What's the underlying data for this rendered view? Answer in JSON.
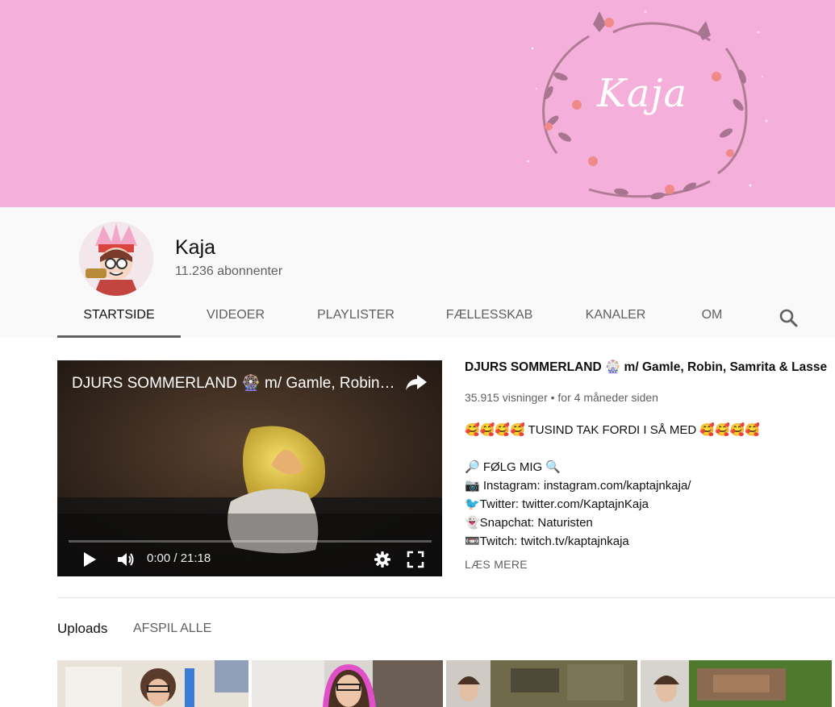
{
  "banner": {
    "name": "Kaja"
  },
  "channel": {
    "name": "Kaja",
    "subscribers": "11.236 abonnenter"
  },
  "tabs": [
    {
      "label": "STARTSIDE",
      "active": true
    },
    {
      "label": "VIDEOER"
    },
    {
      "label": "PLAYLISTER"
    },
    {
      "label": "FÆLLESSKAB"
    },
    {
      "label": "KANALER"
    },
    {
      "label": "OM"
    }
  ],
  "featured": {
    "player_title": "DJURS SOMMERLAND 🎡 m/ Gamle, Robin…",
    "time": "0:00 / 21:18",
    "progress": 0,
    "title": "DJURS SOMMERLAND 🎡 m/ Gamle, Robin, Samrita & Lasse",
    "meta": "35.915 visninger • for 4 måneder siden",
    "description": [
      "🥰🥰🥰🥰 TUSIND TAK FORDI I SÅ MED 🥰🥰🥰🥰",
      "",
      "🔎 FØLG MIG 🔍",
      "📷 Instagram: instagram.com/kaptajnkaja/",
      "🐦Twitter: twitter.com/KaptajnKaja",
      "👻Snapchat: Naturisten",
      "📼Twitch: twitch.tv/kaptajnkaja"
    ],
    "read_more": "LÆS MERE"
  },
  "uploads": {
    "title": "Uploads",
    "play_all": "AFSPIL ALLE"
  },
  "icons": {
    "search": "search-icon",
    "share": "share-icon",
    "play": "play-icon",
    "volume": "volume-icon",
    "settings": "gear-icon",
    "fullscreen": "fullscreen-icon"
  },
  "colors": {
    "banner": "#f4b0da",
    "header_bg": "#f9f9f9",
    "active_tab_underline": "#606060"
  }
}
